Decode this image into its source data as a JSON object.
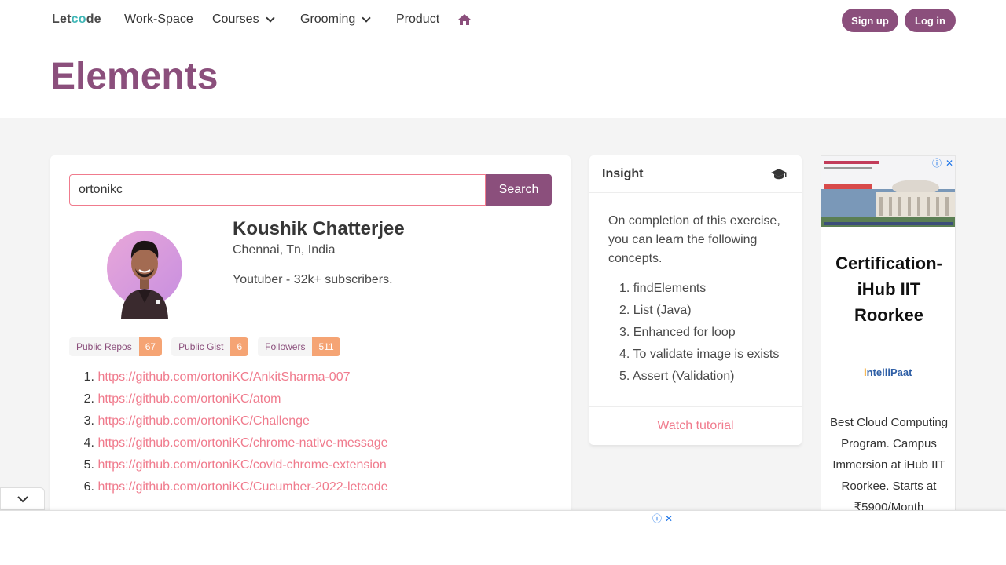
{
  "nav": {
    "logo_pre": "Let",
    "logo_c": "c",
    "logo_o": "o",
    "logo_post": "de",
    "items": [
      {
        "label": "Work-Space"
      },
      {
        "label": "Courses"
      },
      {
        "label": "Grooming"
      },
      {
        "label": "Product"
      }
    ],
    "signup": "Sign up",
    "login": "Log in"
  },
  "page": {
    "title": "Elements"
  },
  "search": {
    "value": "ortonikc",
    "button": "Search"
  },
  "profile": {
    "name": "Koushik Chatterjee",
    "location": "Chennai, Tn, India",
    "bio": "Youtuber - 32k+ subscribers."
  },
  "stats": [
    {
      "label": "Public Repos",
      "value": "67"
    },
    {
      "label": "Public Gist",
      "value": "6"
    },
    {
      "label": "Followers",
      "value": "511"
    }
  ],
  "repos": [
    {
      "num": "1.",
      "url": "https://github.com/ortoniKC/AnkitSharma-007"
    },
    {
      "num": "2.",
      "url": "https://github.com/ortoniKC/atom"
    },
    {
      "num": "3.",
      "url": "https://github.com/ortoniKC/Challenge"
    },
    {
      "num": "4.",
      "url": "https://github.com/ortoniKC/chrome-native-message"
    },
    {
      "num": "5.",
      "url": "https://github.com/ortoniKC/covid-chrome-extension"
    },
    {
      "num": "6.",
      "url": "https://github.com/ortoniKC/Cucumber-2022-letcode"
    }
  ],
  "insight": {
    "title": "Insight",
    "intro": "On completion of this exercise, you can learn the following concepts.",
    "concepts": [
      {
        "num": "1.",
        "text": "findElements"
      },
      {
        "num": "2.",
        "text": "List (Java)"
      },
      {
        "num": "3.",
        "text": "Enhanced for loop"
      },
      {
        "num": "4.",
        "text": "To validate image is exists"
      },
      {
        "num": "5.",
        "text": "Assert (Validation)"
      }
    ],
    "tutorial": "Watch tutorial"
  },
  "ad": {
    "title": "Certification-iHub IIT Roorkee",
    "logo_i": "i",
    "logo_rest": "ntelliPaat",
    "desc": "Best Cloud Computing Program. Campus Immersion at iHub IIT Roorkee. Starts at ₹5900/Month"
  },
  "colors": {
    "brand": "#8b4f7c",
    "link": "#f07b8d",
    "tag_value": "#f5a474"
  }
}
